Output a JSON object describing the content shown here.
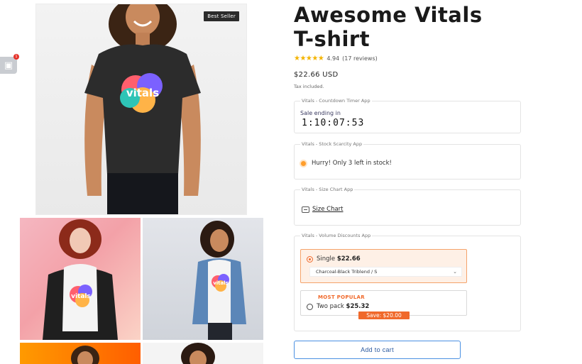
{
  "gallery": {
    "badge": "Best Seller",
    "main_shirt_logo": "vitals",
    "thumb1_logo": "vitals",
    "thumb2_logo": "vitals"
  },
  "floating_app": {
    "badge_count": "1",
    "icon": "gift-icon"
  },
  "product": {
    "title": "Awesome Vitals T-shirt",
    "stars": "★★★★★",
    "rating": "4.94",
    "reviews": "(17 reviews)",
    "price": "$22.66 USD",
    "tax_note": "Tax included."
  },
  "apps": {
    "timer": {
      "label": "Vitals - Countdown Timer App",
      "sale_text": "Sale ending in",
      "countdown": "1:10:07:53"
    },
    "stock": {
      "label": "Vitals - Stock Scarcity App",
      "message": "Hurry! Only 3 left in stock!"
    },
    "size_chart": {
      "label": "Vitals - Size Chart App",
      "link": "Size Chart"
    },
    "volume": {
      "label": "Vitals - Volume Discounts App",
      "single_title": "Single",
      "single_price": "$22.66",
      "variant": "Charcoal-Black Triblend / S",
      "popular": "MOST POPULAR",
      "two_title": "Two pack",
      "two_price": "$25.32",
      "save": "Save: $20.00"
    }
  },
  "cart": {
    "button": "Add to cart"
  },
  "colors": {
    "accent": "#f0692b",
    "star": "#f4b400",
    "cart_border": "#4a90e2"
  }
}
